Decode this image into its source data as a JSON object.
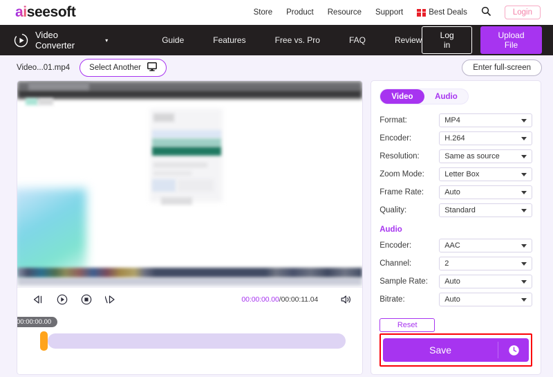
{
  "topbar": {
    "logo_ai": "ai",
    "logo_rest": "seesoft",
    "nav": [
      {
        "label": "Store"
      },
      {
        "label": "Product"
      },
      {
        "label": "Resource"
      },
      {
        "label": "Support"
      }
    ],
    "best_deals": "Best Deals",
    "search_icon": "search-icon",
    "login_label": "Login",
    "accent_pink": "#f481a8"
  },
  "darknav": {
    "brand": "Video Converter",
    "brand_icon": "circle-play-icon",
    "caret": "▾",
    "links": [
      {
        "label": "Guide"
      },
      {
        "label": "Features"
      },
      {
        "label": "Free vs. Pro"
      },
      {
        "label": "FAQ"
      },
      {
        "label": "Review"
      }
    ],
    "login_label": "Log in",
    "upload_label": "Upload File",
    "bg": "#231f20",
    "accent": "#a734f0"
  },
  "filerow": {
    "filename": "Video...01.mp4",
    "select_another_label": "Select Another",
    "select_another_icon": "monitor-icon",
    "fullscreen_label": "Enter full-screen"
  },
  "player": {
    "controls": [
      {
        "name": "previous-frame-icon"
      },
      {
        "name": "play-icon"
      },
      {
        "name": "stop-icon"
      },
      {
        "name": "next-frame-icon"
      }
    ],
    "current_time": "00:00:00.00",
    "time_separator": "/",
    "total_time": "00:00:11.04",
    "volume_icon": "volume-icon",
    "timeline_tooltip": "00:00:00.00",
    "trim_handle_color": "#ffa41c",
    "track_color": "#ded4f4",
    "current_time_color": "#a734f0"
  },
  "settings": {
    "tabs": [
      {
        "label": "Video",
        "active": true
      },
      {
        "label": "Audio",
        "active": false
      }
    ],
    "video_fields": [
      {
        "label": "Format:",
        "value": "MP4"
      },
      {
        "label": "Encoder:",
        "value": "H.264"
      },
      {
        "label": "Resolution:",
        "value": "Same as source"
      },
      {
        "label": "Zoom Mode:",
        "value": "Letter Box"
      },
      {
        "label": "Frame Rate:",
        "value": "Auto"
      },
      {
        "label": "Quality:",
        "value": "Standard"
      }
    ],
    "audio_section_title": "Audio",
    "audio_fields": [
      {
        "label": "Encoder:",
        "value": "AAC"
      },
      {
        "label": "Channel:",
        "value": "2"
      },
      {
        "label": "Sample Rate:",
        "value": "Auto"
      },
      {
        "label": "Bitrate:",
        "value": "Auto"
      }
    ],
    "reset_label": "Reset",
    "save_label": "Save",
    "save_clock_icon": "clock-icon",
    "highlight_color": "#fb0007"
  }
}
